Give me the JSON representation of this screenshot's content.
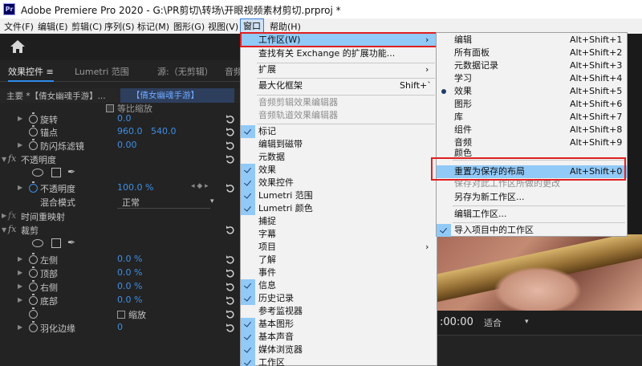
{
  "window": {
    "app_icon": "Pr",
    "title": "Adobe Premiere Pro 2020 - G:\\PR剪切\\转场\\开眼视频素材剪切.prproj *"
  },
  "menubar": [
    {
      "label": "文件(F)"
    },
    {
      "label": "编辑(E)"
    },
    {
      "label": "剪辑(C)"
    },
    {
      "label": "序列(S)"
    },
    {
      "label": "标记(M)"
    },
    {
      "label": "图形(G)"
    },
    {
      "label": "视图(V)"
    },
    {
      "label": "窗口(W)"
    },
    {
      "label": "帮助(H)"
    }
  ],
  "toolbar": {
    "home_icon": "home-icon"
  },
  "panel": {
    "tab_effects": "效果控件",
    "tab_menu": "≡",
    "tab_lumetri": "Lumetri 范围",
    "tab_source": "源:（无剪辑）",
    "tab_audio": "音频",
    "clip_main": "主要 *【倩女幽魂手游】...",
    "clip_seq": "【倩女幽魂手游】",
    "props": {
      "rotation": {
        "label": "旋转",
        "value": "0.0"
      },
      "anchor": {
        "label": "锚点",
        "x": "960.0",
        "y": "540.0"
      },
      "antiflicker": {
        "label": "防闪烁滤镜",
        "value": "0.00"
      },
      "opacity_header": "不透明度",
      "opacity": {
        "label": "不透明度",
        "value": "100.0 %"
      },
      "blend": {
        "label": "混合模式",
        "value": "正常"
      },
      "time_remap": "时间重映射",
      "crop_header": "裁剪",
      "left": {
        "label": "左侧",
        "value": "0.0 %"
      },
      "top": {
        "label": "顶部",
        "value": "0.0 %"
      },
      "right": {
        "label": "右侧",
        "value": "0.0 %"
      },
      "bottom": {
        "label": "底部",
        "value": "0.0 %"
      },
      "zoom": {
        "label": "缩放"
      },
      "feather": {
        "label": "羽化边缘",
        "value": "0"
      },
      "uniform_scale": "等比缩放"
    }
  },
  "window_menu": {
    "items": [
      {
        "label": "工作区(W)",
        "submenu": true,
        "highlight": true
      },
      {
        "label": "查找有关 Exchange 的扩展功能..."
      },
      {
        "label": "扩展",
        "submenu": true
      },
      {
        "label": "最大化框架",
        "shortcut": "Shift+`"
      },
      {
        "label": "音频剪辑效果编辑器",
        "disabled": true
      },
      {
        "label": "音频轨道效果编辑器",
        "disabled": true
      },
      {
        "label": "标记",
        "checked": true
      },
      {
        "label": "编辑到磁带"
      },
      {
        "label": "元数据"
      },
      {
        "label": "效果",
        "checked": true
      },
      {
        "label": "效果控件",
        "checked": true
      },
      {
        "label": "Lumetri 范围",
        "checked": true
      },
      {
        "label": "Lumetri 颜色",
        "checked": true
      },
      {
        "label": "捕捉"
      },
      {
        "label": "字幕"
      },
      {
        "label": "项目",
        "submenu": true
      },
      {
        "label": "了解"
      },
      {
        "label": "事件"
      },
      {
        "label": "信息",
        "checked": true
      },
      {
        "label": "历史记录",
        "checked": true
      },
      {
        "label": "参考监视器"
      },
      {
        "label": "基本图形",
        "checked": true
      },
      {
        "label": "基本声音",
        "checked": true
      },
      {
        "label": "媒体浏览器",
        "checked": true
      },
      {
        "label": "工作区",
        "checked": true
      }
    ]
  },
  "workspace_menu": {
    "items": [
      {
        "label": "编辑",
        "shortcut": "Alt+Shift+1"
      },
      {
        "label": "所有面板",
        "shortcut": "Alt+Shift+2"
      },
      {
        "label": "元数据记录",
        "shortcut": "Alt+Shift+3"
      },
      {
        "label": "学习",
        "shortcut": "Alt+Shift+4"
      },
      {
        "label": "效果",
        "shortcut": "Alt+Shift+5",
        "selected": true
      },
      {
        "label": "图形",
        "shortcut": "Alt+Shift+6"
      },
      {
        "label": "库",
        "shortcut": "Alt+Shift+7"
      },
      {
        "label": "组件",
        "shortcut": "Alt+Shift+8"
      },
      {
        "label": "音频",
        "shortcut": "Alt+Shift+9"
      },
      {
        "label": "颜色"
      },
      {
        "label": "重置为保存的布局",
        "shortcut": "Alt+Shift+0",
        "highlight": true
      },
      {
        "label": "保存对此工作区所做的更改",
        "disabled": true
      },
      {
        "label": "另存为新工作区..."
      },
      {
        "label": "编辑工作区..."
      },
      {
        "label": "导入项目中的工作区",
        "checked": true
      }
    ]
  },
  "monitor": {
    "timecode": ":00:00",
    "fit": "适合"
  },
  "colors": {
    "accent_blue": "#3e8fe5",
    "highlight": "#91c9f7",
    "annotation_red": "#e02020"
  }
}
